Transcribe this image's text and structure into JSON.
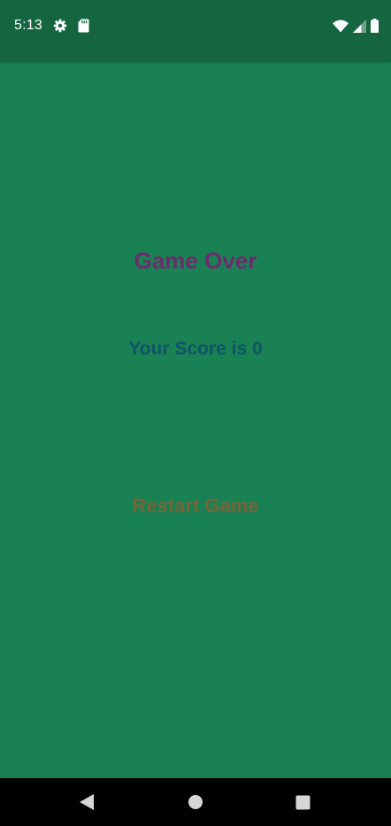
{
  "status_bar": {
    "time": "5:13",
    "icons": [
      "gear-icon",
      "sd-card-icon",
      "wifi-icon",
      "cell-signal-icon",
      "battery-icon"
    ]
  },
  "game": {
    "title": "Game Over",
    "score_text": "Your Score is 0",
    "restart_label": "Restart Game"
  },
  "nav_bar": {
    "buttons": [
      "back-icon",
      "home-icon",
      "recents-icon"
    ]
  },
  "colors": {
    "background": "#198153",
    "status_bar": "#156540",
    "title": "#6b2d6c",
    "score": "#0e5568",
    "restart": "#756538",
    "nav_bar": "#000000"
  }
}
